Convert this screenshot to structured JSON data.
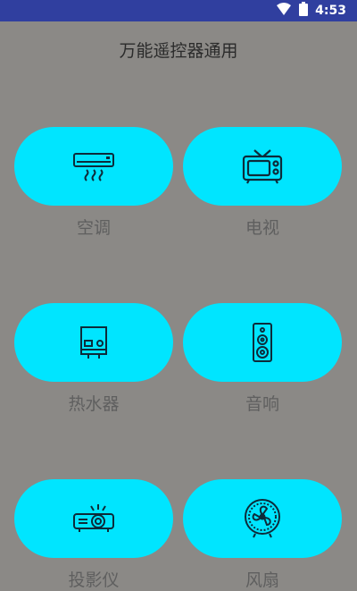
{
  "status_bar": {
    "time": "4:53",
    "icons": [
      "wifi-icon",
      "battery-icon"
    ],
    "background": "#303f9f"
  },
  "header": {
    "title": "万能遥控器通用"
  },
  "devices": [
    {
      "label": "空调",
      "icon": "air-conditioner-icon"
    },
    {
      "label": "电视",
      "icon": "tv-icon"
    },
    {
      "label": "热水器",
      "icon": "water-heater-icon"
    },
    {
      "label": "音响",
      "icon": "speaker-icon"
    },
    {
      "label": "投影仪",
      "icon": "projector-icon"
    },
    {
      "label": "风扇",
      "icon": "fan-icon"
    }
  ],
  "colors": {
    "background": "#8b8986",
    "button": "#00e5ff",
    "icon": "#0d2b3a",
    "label": "#5f5f5f"
  }
}
